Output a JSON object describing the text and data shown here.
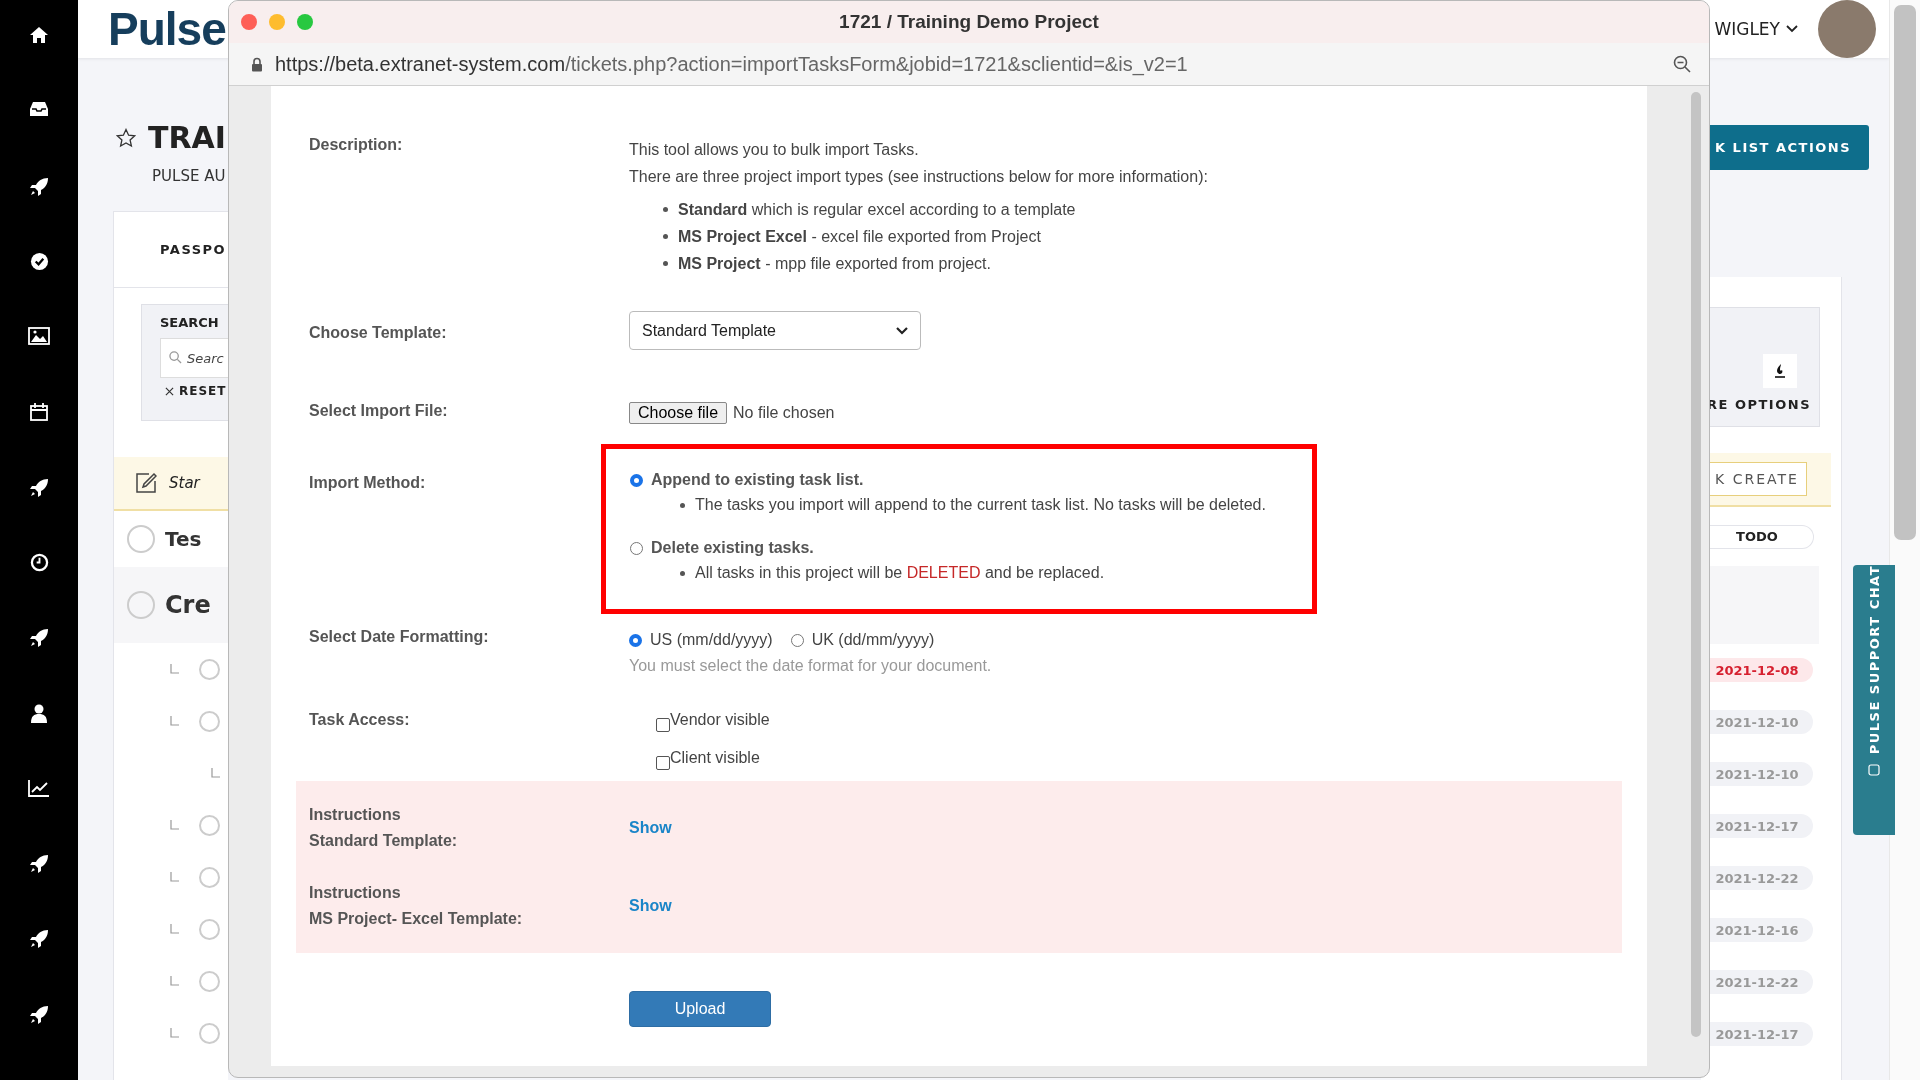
{
  "header": {
    "logo": "Pulse",
    "user": "WIGLEY"
  },
  "page": {
    "title": "TRAI",
    "subtitle": "PULSE AU",
    "tab": "PASSPO",
    "search_label": "SEARCH",
    "search": {
      "placeholder": "Searc"
    },
    "reset": "RESET",
    "actions_button": "K LIST ACTIONS",
    "more_options": "RE OPTIONS",
    "quick_entry": "Star",
    "quick_create": "K CREATE",
    "status_header": "TODO",
    "tasks": [
      {
        "name": "Tes",
        "done": false
      },
      {
        "name": "Cre",
        "done": false,
        "children": [
          {
            "date": "2021-12-08",
            "overdue": true,
            "done": false
          },
          {
            "date": "2021-12-10",
            "overdue": false,
            "done": false,
            "children": [
              {
                "date": "2021-12-10",
                "overdue": false
              }
            ]
          },
          {
            "date": "2021-12-17",
            "overdue": false,
            "done": false
          },
          {
            "date": "2021-12-22",
            "overdue": false,
            "done": false
          },
          {
            "date": "2021-12-16",
            "overdue": false,
            "done": false
          },
          {
            "date": "2021-12-22",
            "overdue": false,
            "done": false
          },
          {
            "date": "2021-12-17",
            "overdue": false,
            "done": false
          }
        ]
      }
    ],
    "support_chat": "PULSE SUPPORT CHAT"
  },
  "popup": {
    "title": "1721 / Training Demo Project",
    "url_host": "https://beta.extranet-system.com",
    "url_path": "/tickets.php?action=importTasksForm&jobid=1721&sclientid=&is_v2=1",
    "description": {
      "label": "Description:",
      "lines": [
        "This tool allows you to bulk import Tasks.",
        "There are three project import types (see instructions below for more information):"
      ],
      "types": [
        "**Standard** which is regular excel according to a template",
        "**MS Project Excel** - excel file exported from Project",
        "**MS Project** - mpp file exported from project."
      ]
    },
    "template": {
      "label": "Choose Template:",
      "value": "Standard Template"
    },
    "import_file": {
      "label": "Select Import File:",
      "button": "Choose file",
      "status": "No file chosen"
    },
    "import_method": {
      "label": "Import Method:",
      "highlighted": true,
      "options": [
        {
          "label": "Append to existing task list.",
          "selected": true,
          "note": [
            {
              "text": "The tasks you import will append to the current task list. No tasks will be deleted.",
              "warning": false
            }
          ]
        },
        {
          "label": "Delete existing tasks.",
          "selected": false,
          "note": [
            {
              "text": "All tasks in this project will be ",
              "warning": false
            },
            {
              "text": "DELETED",
              "warning": true
            },
            {
              "text": " and be replaced.",
              "warning": false
            }
          ]
        }
      ]
    },
    "date_format": {
      "label": "Select Date Formatting:",
      "options": [
        {
          "label": "US (mm/dd/yyyy)",
          "selected": true
        },
        {
          "label": "UK (dd/mm/yyyy)",
          "selected": false
        }
      ],
      "hint": "You must select the date format for your document."
    },
    "task_access": {
      "label": "Task Access:",
      "options": [
        {
          "label": "Vendor visible",
          "checked": false
        },
        {
          "label": "Client visible",
          "checked": false
        }
      ]
    },
    "instructions": [
      {
        "title": "Instructions",
        "template": "Standard Template:",
        "link": "Show"
      },
      {
        "title": "Instructions",
        "template": "MS Project- Excel Template:",
        "link": "Show"
      }
    ],
    "upload_button": "Upload"
  }
}
